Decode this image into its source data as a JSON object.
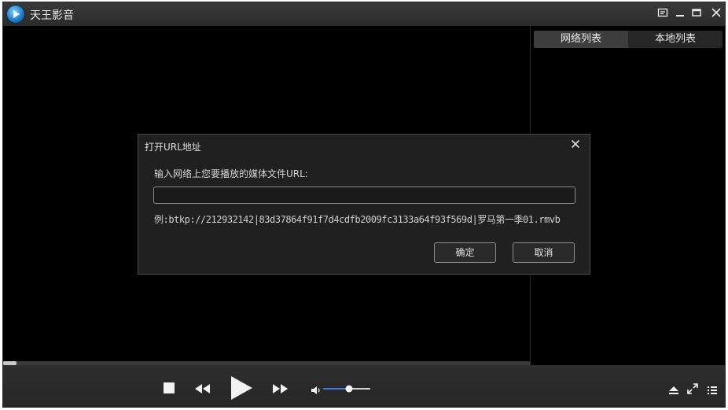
{
  "app": {
    "title": "天王影音"
  },
  "titlebar": {
    "buttons": [
      {
        "name": "mini-mode-icon",
        "glyph": "⧉"
      },
      {
        "name": "minimize-icon",
        "glyph": "—"
      },
      {
        "name": "maximize-icon",
        "glyph": "▭"
      },
      {
        "name": "close-icon",
        "glyph": "✕"
      }
    ]
  },
  "playlist": {
    "tabs": [
      {
        "label": "网络列表",
        "active": true
      },
      {
        "label": "本地列表",
        "active": false
      }
    ]
  },
  "dialog": {
    "title": "打开URL地址",
    "prompt": "输入网络上您要播放的媒体文件URL:",
    "input_value": "",
    "example": "例:btkp://212932142|83d37864f91f7d4cdfb2009fc3133a64f93f569d|罗马第一季01.rmvb",
    "confirm_label": "确定",
    "cancel_label": "取消"
  },
  "player": {
    "progress": 0.025,
    "volume": 0.55
  },
  "colors": {
    "accent": "#3a7bd5",
    "bg": "#000000",
    "bar": "#2b2b2b"
  }
}
